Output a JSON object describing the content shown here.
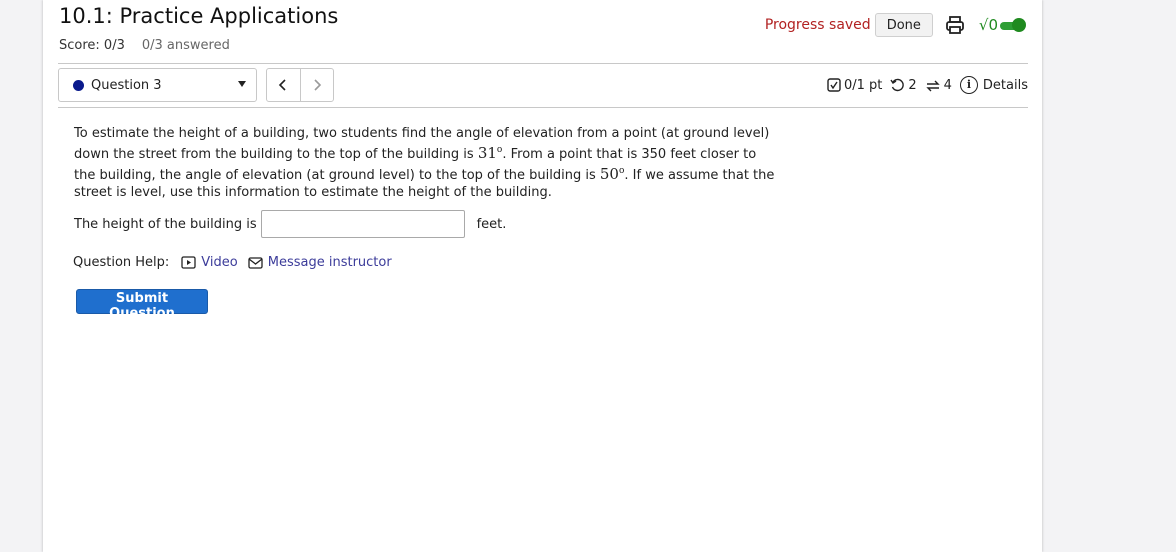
{
  "header": {
    "title": "10.1: Practice Applications",
    "score_label": "Score: 0/3",
    "answered_label": "0/3 answered",
    "progress_text": "Progress saved",
    "done_label": "Done",
    "sqrt_label": "√0"
  },
  "question_nav": {
    "selected": "Question 3",
    "prev_label": "‹",
    "next_label": "›",
    "dot_color": "#0a1a8c"
  },
  "meta": {
    "points": "0/1 pt",
    "retries": "2",
    "attempts": "4",
    "details_label": "Details"
  },
  "question": {
    "text_part1": "To estimate the height of a building, two students find the angle of elevation from a point (at ground level) down the street from the building to the top of the building is ",
    "angle1": "31",
    "angle1_unit": "o",
    "text_part2": ". From a point that is 350 feet closer to the building, the angle of elevation (at ground level) to the top of the building is ",
    "angle2": "50",
    "angle2_unit": "o",
    "text_part3": ". If we assume that the street is level, use this information to estimate the height of the building."
  },
  "answer": {
    "prefix": "The height of the building is",
    "value": "",
    "suffix": "feet."
  },
  "help": {
    "label": "Question Help:",
    "video_label": "Video",
    "message_label": "Message instructor"
  },
  "submit_label": "Submit Question",
  "colors": {
    "progress_red": "#b22222",
    "toggle_green": "#2e9e35",
    "submit_blue": "#1f6fce",
    "link": "#3c3c9a"
  }
}
